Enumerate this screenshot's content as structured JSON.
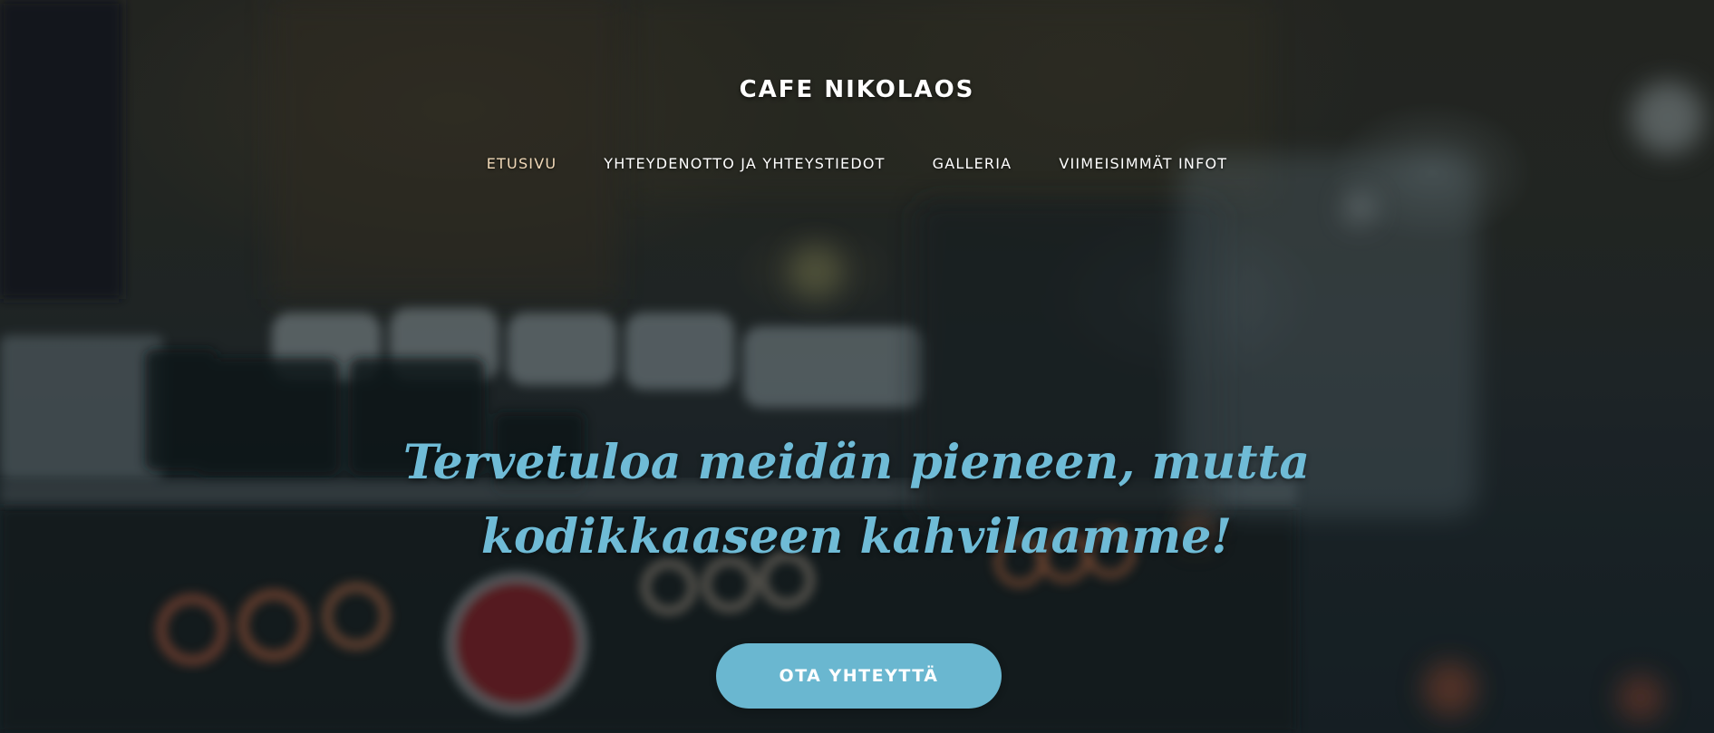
{
  "header": {
    "site_title": "CAFE NIKOLAOS"
  },
  "nav": {
    "items": [
      {
        "label": "ETUSIVU",
        "active": true
      },
      {
        "label": "YHTEYDENOTTO JA YHTEYSTIEDOT",
        "active": false
      },
      {
        "label": "GALLERIA",
        "active": false
      },
      {
        "label": "VIIMEISIMMÄT INFOT",
        "active": false
      }
    ]
  },
  "hero": {
    "headline": "Tervetuloa meidän pieneen, mutta kodikkaaseen kahvilaamme!",
    "cta_label": "OTA YHTEYTTÄ",
    "background_image": "espresso-machine-photo"
  },
  "colors": {
    "accent": "#6ab7d0",
    "headline": "#6fbbd6",
    "nav_active": "#f1d9b8",
    "nav_text": "#ffffff"
  }
}
